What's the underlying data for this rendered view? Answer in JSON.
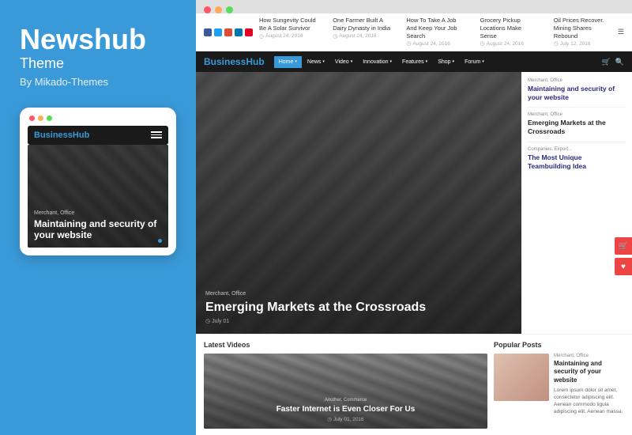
{
  "left": {
    "brand": "Newshub",
    "subtitle": "Theme",
    "by": "By Mikado-Themes",
    "mobile": {
      "logo_main": "Business",
      "logo_accent": "Hub",
      "tag": "Merchant, Office",
      "hero_title": "Maintaining and security of your website"
    }
  },
  "browser": {
    "dots": [
      {
        "color": "#f56"
      },
      {
        "color": "#fa5"
      },
      {
        "color": "#5d5"
      }
    ]
  },
  "ticker": {
    "items": [
      {
        "title": "How Sungevity Could Be A Solar Survivor",
        "date": "August 24, 2016"
      },
      {
        "title": "One Farmer Built A Dairy Dynasty in India",
        "date": "August 24, 2016"
      },
      {
        "title": "How To Take A Job And Keep Your Job Search",
        "date": "August 24, 2016"
      },
      {
        "title": "Grocery Pickup Locations Make Sense",
        "date": "August 24, 2016"
      },
      {
        "title": "Oil Prices Recover. Mining Shares Rebound",
        "date": "July 12, 2016"
      }
    ]
  },
  "nav": {
    "logo_main": "Business",
    "logo_accent": "Hub",
    "items": [
      {
        "label": "Home",
        "active": true,
        "has_arrow": true
      },
      {
        "label": "News",
        "active": false,
        "has_arrow": true
      },
      {
        "label": "Video",
        "active": false,
        "has_arrow": true
      },
      {
        "label": "Innovation",
        "active": false,
        "has_arrow": true
      },
      {
        "label": "Features",
        "active": false,
        "has_arrow": true
      },
      {
        "label": "Shop",
        "active": false,
        "has_arrow": true
      },
      {
        "label": "Forum",
        "active": false,
        "has_arrow": true
      }
    ]
  },
  "hero": {
    "tag": "Merchant, Office",
    "title": "Emerging Markets at the Crossroads",
    "date": "July 01",
    "sidebar": [
      {
        "tag": "Merchant, Office",
        "title": "Maintaining and security of your website",
        "accent": true
      },
      {
        "tag": "Merchant, Office",
        "title": "Emerging Markets at the Crossroads",
        "accent": false
      },
      {
        "tag": "Companies, Export...",
        "title": "The Most Unique Teambuilding Idea",
        "accent": true
      }
    ]
  },
  "bottom": {
    "videos_label": "Latest Videos",
    "popular_label": "Popular Posts",
    "video": {
      "tag": "Another, Commerce",
      "title": "Faster Internet is Even Closer For Us",
      "date": "July 01, 2016"
    },
    "popular": {
      "tag": "Merchant, Office",
      "title": "Maintaining and security of your website",
      "desc": "Lorem ipsum dolor sit amet, consectetur adipiscing elit. Aenean commodo ligula adipiscing elit. Aenean massa."
    }
  },
  "mobile_dots": [
    {
      "color": "#f56"
    },
    {
      "color": "#fa5"
    },
    {
      "color": "#5d5"
    }
  ]
}
